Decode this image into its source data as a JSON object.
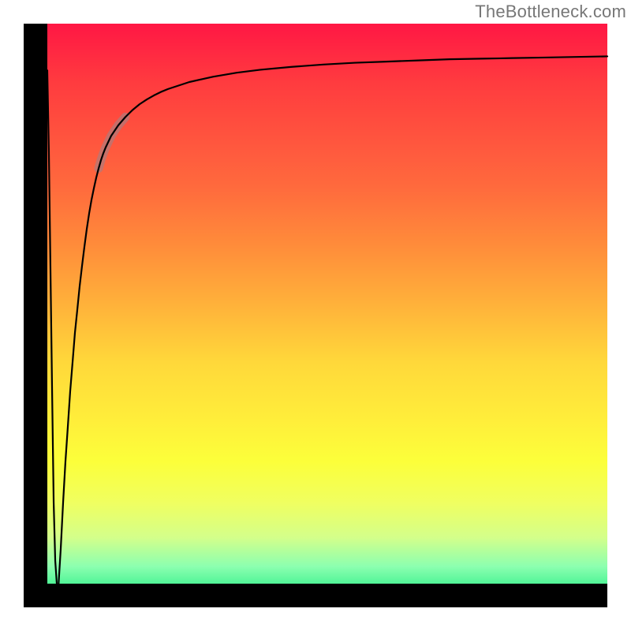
{
  "watermark": "TheBottleneck.com",
  "colors": {
    "curve": "#000000",
    "highlight_segment": "#b07a7a",
    "gradient_top": "#ff1744",
    "gradient_mid": "#ffee3a",
    "gradient_bottom": "#00e676",
    "frame": "#000000"
  },
  "chart_data": {
    "type": "line",
    "title": "",
    "xlabel": "",
    "ylabel": "",
    "xlim": [
      0,
      100
    ],
    "ylim": [
      0,
      100
    ],
    "grid": false,
    "legend": false,
    "x": [
      4.05,
      4.32,
      4.59,
      4.86,
      5.14,
      5.41,
      5.68,
      5.95,
      6.35,
      6.76,
      7.16,
      7.57,
      7.97,
      8.38,
      8.78,
      9.19,
      9.59,
      10.0,
      10.41,
      10.81,
      11.22,
      11.62,
      12.03,
      12.43,
      12.84,
      13.24,
      13.65,
      14.05,
      15.0,
      16.22,
      17.43,
      18.65,
      19.86,
      21.08,
      22.3,
      23.51,
      24.73,
      28.38,
      32.43,
      36.49,
      40.54,
      45.95,
      51.35,
      56.76,
      62.16,
      67.57,
      72.97,
      78.38,
      83.78,
      89.19,
      94.59,
      100.0
    ],
    "values": [
      92.0,
      78.0,
      58.0,
      38.0,
      18.0,
      8.0,
      4.0,
      3.5,
      10.0,
      18.0,
      25.0,
      31.0,
      37.0,
      42.0,
      47.0,
      51.0,
      55.0,
      58.5,
      61.8,
      64.8,
      67.5,
      69.8,
      71.8,
      73.6,
      75.2,
      76.6,
      77.8,
      78.8,
      80.8,
      82.6,
      84.0,
      85.2,
      86.2,
      87.0,
      87.7,
      88.3,
      88.8,
      90.0,
      90.9,
      91.6,
      92.1,
      92.6,
      93.0,
      93.3,
      93.5,
      93.7,
      93.9,
      94.0,
      94.1,
      94.2,
      94.3,
      94.4
    ],
    "highlight_range_x": [
      12.5,
      18.0
    ]
  }
}
